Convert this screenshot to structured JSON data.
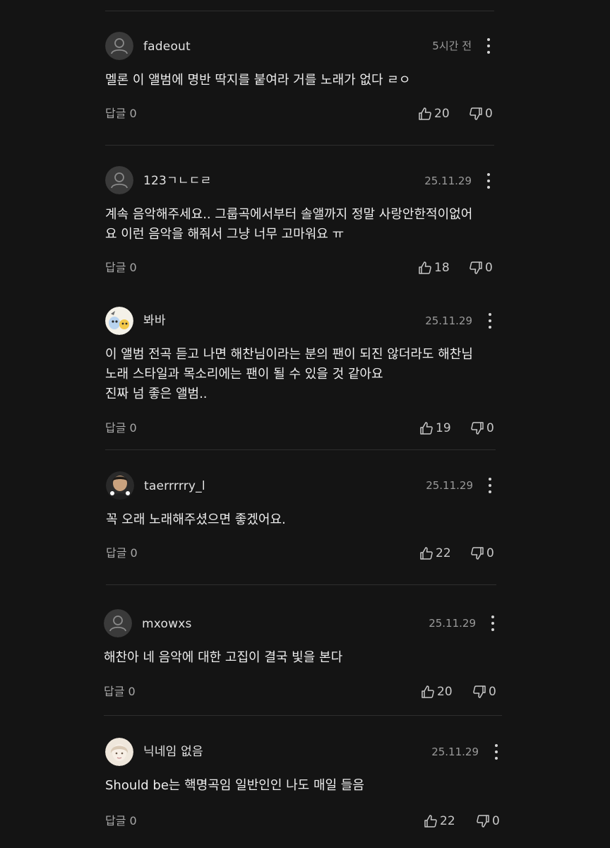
{
  "comments": [
    {
      "user": "fadeout",
      "time": "5시간 전",
      "text": "멜론 이 앨범에 명반 딱지를 붙여라 거를 노래가 없다 ㄹㅇ",
      "reply_label": "답글",
      "reply_count": "0",
      "likes": "20",
      "dislikes": "0",
      "avatar": "default-person-icon"
    },
    {
      "user": "123ㄱㄴㄷㄹ",
      "time": "25.11.29",
      "text": "계속 음악해주세요.. 그룹곡에서부터 솔앨까지 정말 사랑안한적이없어\n요 이런 음악을 해줘서 그냥 너무 고마워요 ㅠ",
      "reply_label": "답글",
      "reply_count": "0",
      "likes": "18",
      "dislikes": "0",
      "avatar": "default-person-icon"
    },
    {
      "user": "봐바",
      "time": "25.11.29",
      "text": "이 앨범 전곡 듣고 나면 해찬님이라는 분의 팬이 되진 않더라도 해찬님\n노래 스타일과 목소리에는 팬이 될 수 있을 것 같아요\n진짜 넘 좋은 앨범..",
      "reply_label": "답글",
      "reply_count": "0",
      "likes": "19",
      "dislikes": "0",
      "avatar": "cartoon-avatar"
    },
    {
      "user": "taerrrrry_l",
      "time": "25.11.29",
      "text": "꼭 오래 노래해주셨으면 좋겠어요.",
      "reply_label": "답글",
      "reply_count": "0",
      "likes": "22",
      "dislikes": "0",
      "avatar": "photo-avatar"
    },
    {
      "user": "mxowxs",
      "time": "25.11.29",
      "text": "해찬아 네 음악에 대한 고집이 결국 빛을 본다",
      "reply_label": "답글",
      "reply_count": "0",
      "likes": "20",
      "dislikes": "0",
      "avatar": "default-person-icon"
    },
    {
      "user": "닉네임 없음",
      "time": "25.11.29",
      "text": "Should be는 핵명곡임 일반인인 나도 매일 들음",
      "reply_label": "답글",
      "reply_count": "0",
      "likes": "22",
      "dislikes": "0",
      "avatar": "illustration-avatar"
    }
  ],
  "colors": {
    "background": "#141414",
    "divider": "#2e2e2e",
    "text": "#ececec",
    "muted": "#9a9a9a"
  }
}
